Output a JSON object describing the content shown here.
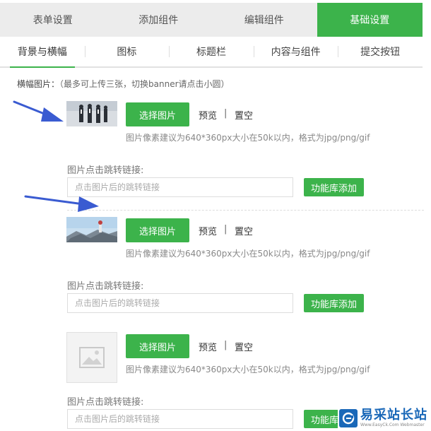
{
  "tabs": [
    {
      "label": "表单设置",
      "active": false
    },
    {
      "label": "添加组件",
      "active": false
    },
    {
      "label": "编辑组件",
      "active": false
    },
    {
      "label": "基础设置",
      "active": true
    }
  ],
  "subtabs": [
    {
      "label": "背景与横幅",
      "active": true
    },
    {
      "label": "图标",
      "active": false
    },
    {
      "label": "标题栏",
      "active": false
    },
    {
      "label": "内容与组件",
      "active": false
    },
    {
      "label": "提交按钮",
      "active": false
    }
  ],
  "banner": {
    "label": "横幅图片：",
    "hint": "（最多可上传三张，切换banner请点击小圆）",
    "select_label": "选择图片",
    "preview_label": "预览",
    "separator": "|",
    "clear_label": "置空",
    "size_tip": "图片像素建议为640*360px大小在50k以内，格式为jpg/png/gif",
    "link_label": "图片点击跳转链接:",
    "link_placeholder": "点击图片后的跳转链接",
    "library_label": "功能库添加"
  },
  "watermark": {
    "title": "易采站长站",
    "subtitle": "Www.EasyCk.Com Webmaster"
  },
  "colors": {
    "accent": "#3cb34b",
    "annotation_arrow": "#3a5bd1"
  }
}
